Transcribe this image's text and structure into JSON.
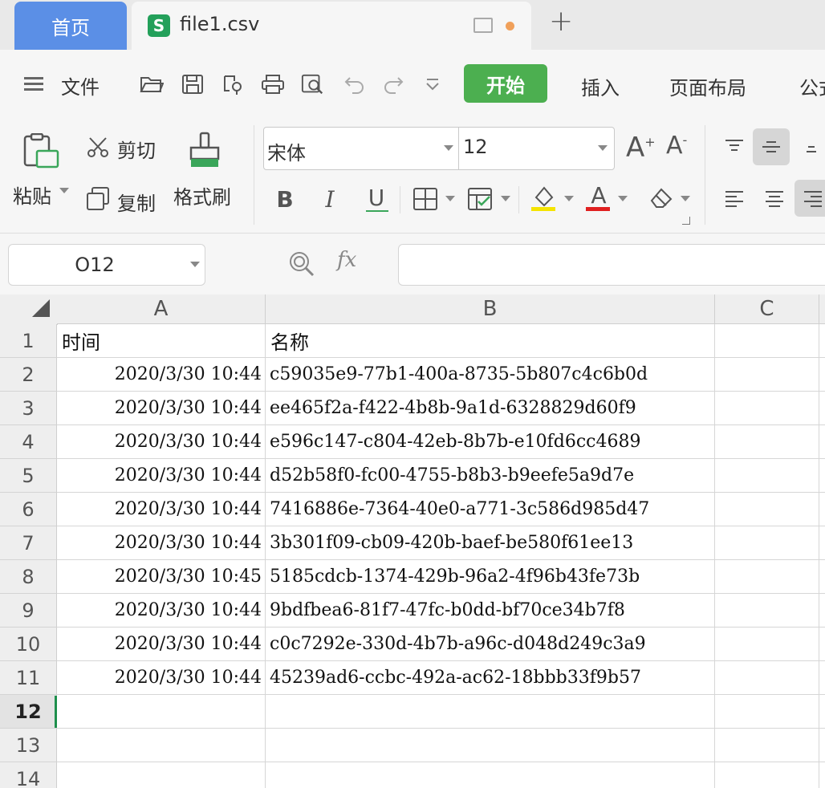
{
  "tabs": {
    "home": "首页",
    "file": "file1.csv",
    "file_icon": "S",
    "new_tab": "+"
  },
  "ribbon": {
    "menu_label": "文件",
    "tabs": [
      "开始",
      "插入",
      "页面布局",
      "公式"
    ],
    "paste": "粘贴",
    "cut": "剪切",
    "copy": "复制",
    "format_painter": "格式刷",
    "font_name": "宋体",
    "font_size": "12",
    "bold": "B",
    "italic": "I",
    "underline": "U",
    "grow_font": "A",
    "shrink_font": "A",
    "font_color_glyph": "A",
    "colors": {
      "accent": "#4caf50",
      "home_tab": "#5b8fe6",
      "highlight": "#f5e400",
      "font_color": "#e02020",
      "active_cell": "#1e8f4c"
    }
  },
  "formula_bar": {
    "name_box": "O12",
    "fx": "fx",
    "formula": ""
  },
  "sheet": {
    "columns": [
      "A",
      "B",
      "C"
    ],
    "rows": [
      {
        "num": "1",
        "a": "时间",
        "b": "名称"
      },
      {
        "num": "2",
        "a": "2020/3/30 10:44",
        "b": "c59035e9-77b1-400a-8735-5b807c4c6b0d"
      },
      {
        "num": "3",
        "a": "2020/3/30 10:44",
        "b": "ee465f2a-f422-4b8b-9a1d-6328829d60f9"
      },
      {
        "num": "4",
        "a": "2020/3/30 10:44",
        "b": "e596c147-c804-42eb-8b7b-e10fd6cc4689"
      },
      {
        "num": "5",
        "a": "2020/3/30 10:44",
        "b": "d52b58f0-fc00-4755-b8b3-b9eefe5a9d7e"
      },
      {
        "num": "6",
        "a": "2020/3/30 10:44",
        "b": "7416886e-7364-40e0-a771-3c586d985d47"
      },
      {
        "num": "7",
        "a": "2020/3/30 10:44",
        "b": "3b301f09-cb09-420b-baef-be580f61ee13"
      },
      {
        "num": "8",
        "a": "2020/3/30 10:45",
        "b": "5185cdcb-1374-429b-96a2-4f96b43fe73b"
      },
      {
        "num": "9",
        "a": "2020/3/30 10:44",
        "b": "9bdfbea6-81f7-47fc-b0dd-bf70ce34b7f8"
      },
      {
        "num": "10",
        "a": "2020/3/30 10:44",
        "b": "c0c7292e-330d-4b7b-a96c-d048d249c3a9"
      },
      {
        "num": "11",
        "a": "2020/3/30 10:44",
        "b": "45239ad6-ccbc-492a-ac62-18bbb33f9b57"
      },
      {
        "num": "12",
        "a": "",
        "b": ""
      },
      {
        "num": "13",
        "a": "",
        "b": ""
      },
      {
        "num": "14",
        "a": "",
        "b": ""
      }
    ]
  }
}
